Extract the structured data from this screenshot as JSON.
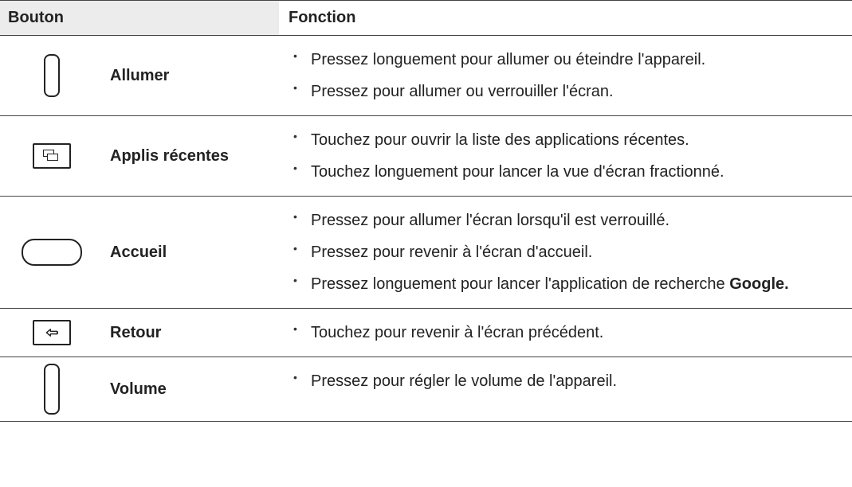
{
  "header": {
    "button": "Bouton",
    "function": "Fonction"
  },
  "rows": [
    {
      "name": "Allumer",
      "icon": "power",
      "functions": [
        "Pressez longuement pour allumer ou éteindre l'appareil.",
        "Pressez pour allumer ou verrouiller l'écran."
      ]
    },
    {
      "name": "Applis récentes",
      "icon": "recent",
      "functions": [
        "Touchez pour ouvrir la liste des applications récentes.",
        "Touchez longuement pour lancer la vue d'écran fractionné."
      ]
    },
    {
      "name": "Accueil",
      "icon": "home",
      "functions": [
        "Pressez pour allumer l'écran lorsqu'il est verrouillé.",
        "Pressez pour revenir à l'écran d'accueil.",
        "Pressez longuement pour lancer l'application de recherche "
      ],
      "functions_bold_suffix": "Google."
    },
    {
      "name": "Retour",
      "icon": "back",
      "functions": [
        "Touchez pour revenir à l'écran précédent."
      ]
    },
    {
      "name": "Volume",
      "icon": "volume",
      "functions": [
        "Pressez pour régler le volume de l'appareil."
      ]
    }
  ]
}
